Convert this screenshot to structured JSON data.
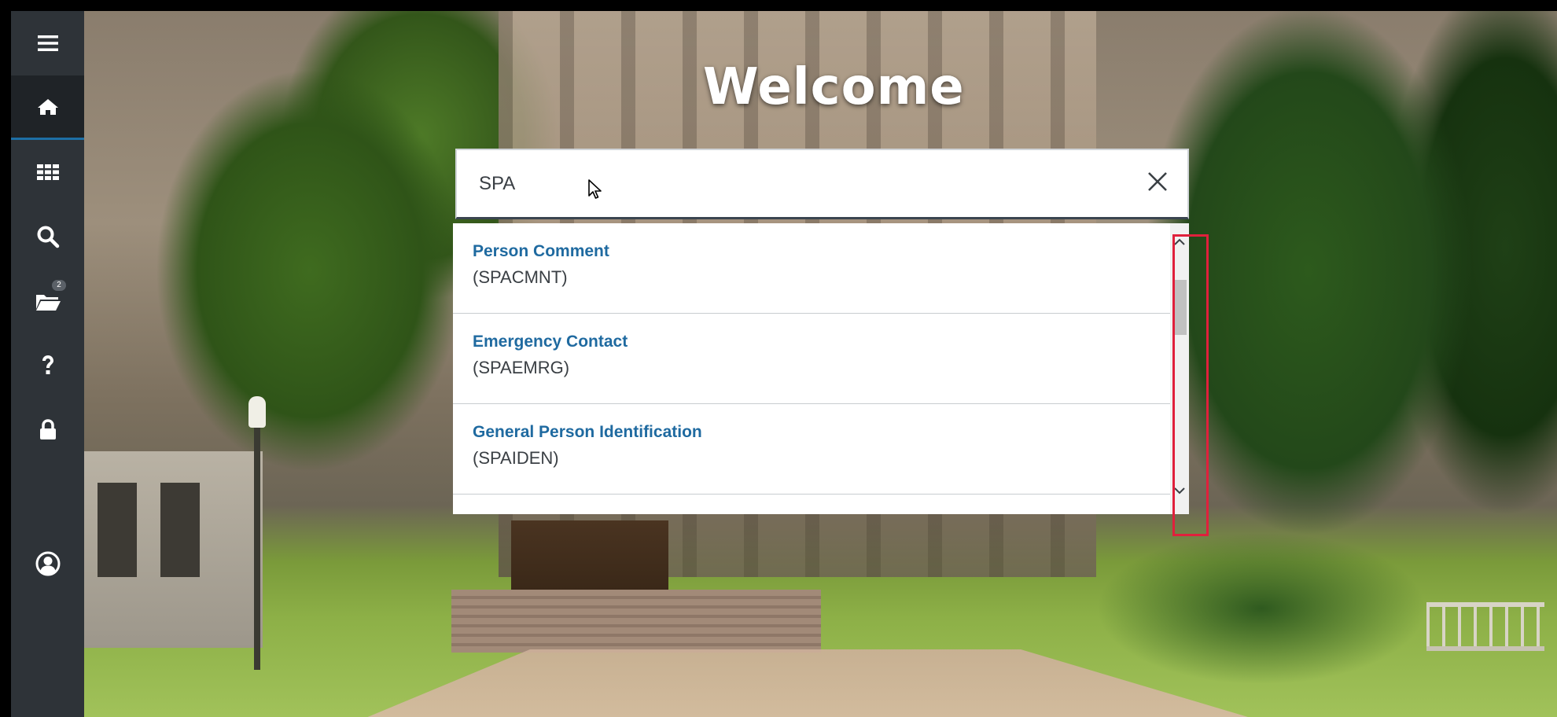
{
  "page": {
    "welcome_title": "Welcome"
  },
  "sidebar": {
    "items": [
      {
        "id": "menu",
        "icon": "hamburger-menu-icon"
      },
      {
        "id": "home",
        "icon": "home-icon",
        "active": true
      },
      {
        "id": "applications",
        "icon": "grid-icon"
      },
      {
        "id": "search",
        "icon": "search-icon"
      },
      {
        "id": "recent",
        "icon": "folder-open-icon",
        "badge": "2"
      },
      {
        "id": "help",
        "icon": "question-icon"
      },
      {
        "id": "lock",
        "icon": "lock-icon"
      },
      {
        "id": "profile",
        "icon": "user-circle-icon"
      }
    ]
  },
  "search": {
    "value": "SPA",
    "clear_icon": "close-icon"
  },
  "results": [
    {
      "title": "Person Comment",
      "code": "(SPACMNT)"
    },
    {
      "title": "Emergency Contact",
      "code": "(SPAEMRG)"
    },
    {
      "title": "General Person Identification",
      "code": "(SPAIDEN)"
    }
  ],
  "colors": {
    "sidebar_bg": "#2e3338",
    "link_blue": "#1f6aa0",
    "highlight_red": "#e0203c",
    "active_underline": "#1d6fa5"
  }
}
